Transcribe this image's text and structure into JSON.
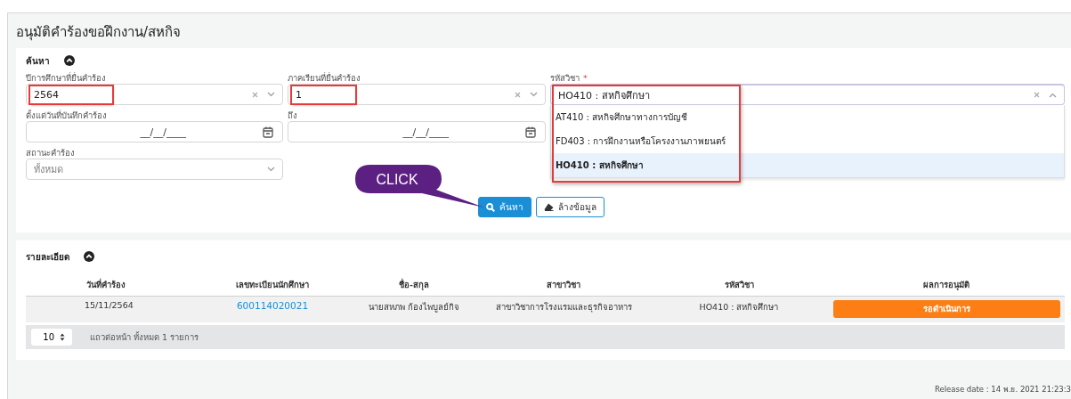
{
  "page": {
    "title": "อนุมัติคำร้องขอฝึกงาน/สหกิจ"
  },
  "search": {
    "heading": "ค้นหา",
    "expanded": true,
    "field_rows": [
      [
        {
          "kind": "select",
          "label": "ปีการศึกษาที่ยื่นคำร้อง",
          "value": "2564",
          "highlighted": true
        },
        {
          "kind": "select",
          "label": "ภาคเรียนที่ยื่นคำร้อง",
          "value": "1",
          "highlighted": true
        },
        {
          "kind": "combo",
          "label": "รหัสวิชา",
          "required_mark": "*",
          "value": "HO410 : สหกิจศึกษา",
          "open": true,
          "highlighted": true,
          "options": [
            {
              "label": "AT410 : สหกิจศึกษาทางการบัญชี",
              "selected": false
            },
            {
              "label": "FD403 : การฝึกงานหรือโครงงานภาพยนตร์",
              "selected": false
            },
            {
              "label": "HO410 : สหกิจศึกษา",
              "selected": true
            }
          ]
        }
      ],
      [
        {
          "kind": "date",
          "label": "ตั้งแต่วันที่บันทึกคำร้อง",
          "placeholder": "__/__/____"
        },
        {
          "kind": "date",
          "label": "ถึง",
          "placeholder": "__/__/____"
        }
      ],
      [
        {
          "kind": "select",
          "label": "สถานะคำร้อง",
          "placeholder": "ทั้งหมด"
        }
      ]
    ],
    "callout": "CLICK",
    "buttons": [
      {
        "kind": "search",
        "label": "ค้นหา"
      },
      {
        "kind": "clear",
        "label": "ล้างข้อมูล"
      }
    ]
  },
  "details": {
    "heading": "รายละเอียด",
    "expanded": true,
    "table": {
      "columns": [
        "วันที่คำร้อง",
        "เลขทะเบียนนักศึกษา",
        "ชื่อ-สกุล",
        "สาขาวิชา",
        "รหัสวิชา",
        "ผลการอนุมัติ"
      ],
      "rows": [
        {
          "date": "15/11/2564",
          "student_id": "600114020021",
          "name": "นายสหภพ ก้องไพบูลย์กิจ",
          "major": "สาขาวิชาการโรงแรมและธุรกิจอาหาร",
          "course": "HO410 : สหกิจศึกษา",
          "result": "รอดำเนินการ"
        }
      ]
    },
    "page_size": "10",
    "summary": "แถวต่อหน้า ทั้งหมด 1 รายการ"
  },
  "footer": {
    "release": "Release date : 14 พ.ย. 2021 21:23:3"
  }
}
